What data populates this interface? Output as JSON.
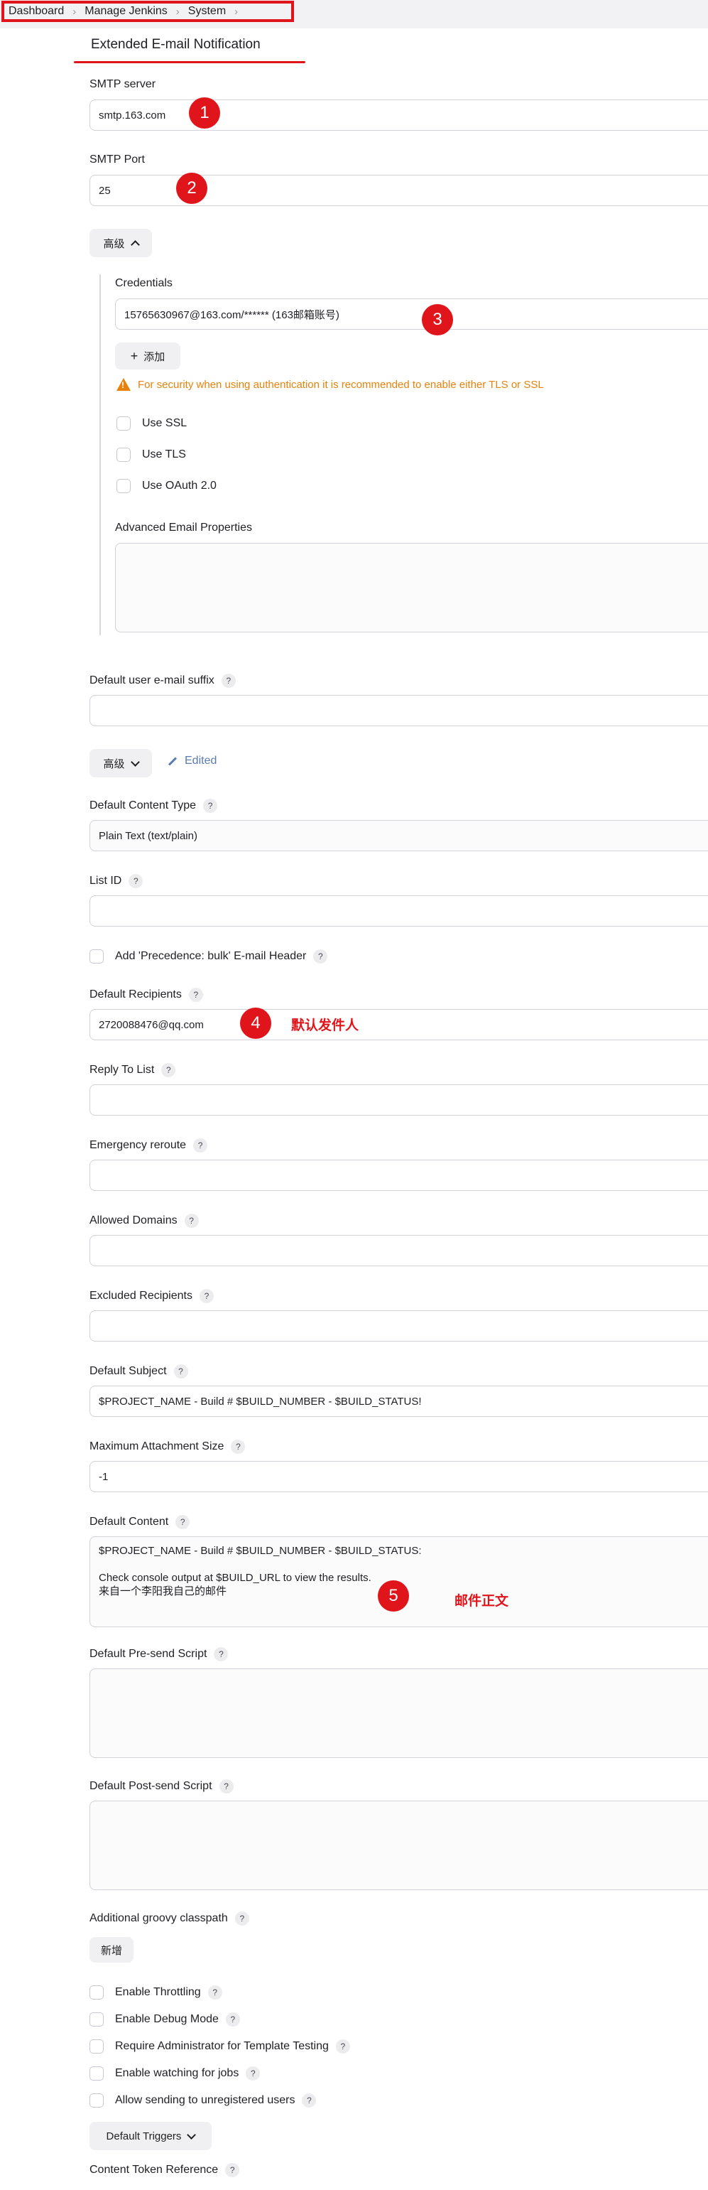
{
  "breadcrumb": [
    "Dashboard",
    "Manage Jenkins",
    "System"
  ],
  "section_title": "Extended E-mail Notification",
  "smtp_server": {
    "label": "SMTP server",
    "value": "smtp.163.com"
  },
  "smtp_port": {
    "label": "SMTP Port",
    "value": "25"
  },
  "advanced_button": "高级",
  "credentials": {
    "label": "Credentials",
    "value": "15765630967@163.com/****** (163邮箱账号)"
  },
  "add_button": "添加",
  "security_warning": "For security when using authentication it is recommended to enable either TLS or SSL",
  "use_ssl": "Use SSL",
  "use_tls": "Use TLS",
  "use_oauth": "Use OAuth 2.0",
  "advanced_email_properties": "Advanced Email Properties",
  "default_user_email_suffix": "Default user e-mail suffix",
  "advanced_button_2": "高级",
  "edited_label": "Edited",
  "default_content_type": {
    "label": "Default Content Type",
    "value": "Plain Text (text/plain)"
  },
  "list_id": "List ID",
  "precedence_bulk": "Add 'Precedence: bulk' E-mail Header",
  "default_recipients": {
    "label": "Default Recipients",
    "value": "2720088476@qq.com"
  },
  "reply_to_list": "Reply To List",
  "emergency_reroute": "Emergency reroute",
  "allowed_domains": "Allowed Domains",
  "excluded_recipients": "Excluded Recipients",
  "default_subject": {
    "label": "Default Subject",
    "value": "$PROJECT_NAME - Build # $BUILD_NUMBER - $BUILD_STATUS!"
  },
  "max_attachment_size": {
    "label": "Maximum Attachment Size",
    "value": "-1"
  },
  "default_content": {
    "label": "Default Content",
    "value": "$PROJECT_NAME - Build # $BUILD_NUMBER - $BUILD_STATUS:\n\nCheck console output at $BUILD_URL to view the results.\n来自一个李阳我自己的邮件"
  },
  "default_presend_script": "Default Pre-send Script",
  "default_postsend_script": "Default Post-send Script",
  "additional_groovy_classpath": "Additional groovy classpath",
  "new_button": "新增",
  "enable_throttling": "Enable Throttling",
  "enable_debug_mode": "Enable Debug Mode",
  "require_admin_template": "Require Administrator for Template Testing",
  "enable_watching_jobs": "Enable watching for jobs",
  "allow_unregistered": "Allow sending to unregistered users",
  "default_triggers": "Default Triggers",
  "content_token_reference": "Content Token Reference",
  "help_glyph": "?",
  "annotations": {
    "m1": "1",
    "m2": "2",
    "m3": "3",
    "m4": "4",
    "m5": "5",
    "recipient_note": "默认发件人",
    "content_note": "邮件正文"
  },
  "colors": {
    "annotation_red": "#e0151b",
    "warning_orange": "#e8820c",
    "link_blue": "#5a7bb0"
  }
}
